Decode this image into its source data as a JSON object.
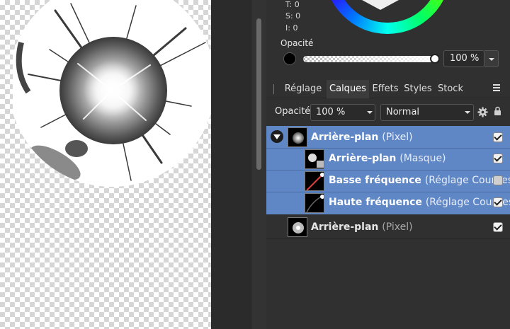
{
  "color_panel": {
    "readouts": [
      "T: 0",
      "S: 0",
      "I: 0"
    ],
    "opacity_label": "Opacité",
    "opacity_value": "100 %",
    "opacity_fraction": 1.0,
    "swatch_color": "#000000"
  },
  "tabs": [
    {
      "label": "Réglage",
      "active": false
    },
    {
      "label": "Calques",
      "active": true
    },
    {
      "label": "Effets",
      "active": false
    },
    {
      "label": "Styles",
      "active": false
    },
    {
      "label": "Stock",
      "active": false
    }
  ],
  "layers_toolbar": {
    "opacity_label": "Opacité:",
    "opacity_value": "100 %",
    "blend_mode": "Normal"
  },
  "layers": [
    {
      "name": "Arrière-plan",
      "type": "(Pixel)",
      "checked": true,
      "selected": true,
      "expanded": true,
      "indent": 0,
      "thumb": "starburst"
    },
    {
      "name": "Arrière-plan",
      "type": "(Masque)",
      "checked": true,
      "selected": true,
      "indent": 1,
      "thumb": "starburst-mask"
    },
    {
      "name": "Basse fréquence",
      "type": "(Réglage Courbes)",
      "checked": false,
      "selected": true,
      "indent": 1,
      "thumb": "curves-off"
    },
    {
      "name": "Haute fréquence",
      "type": "(Réglage Courbes)",
      "checked": true,
      "selected": true,
      "indent": 1,
      "thumb": "curves"
    },
    {
      "name": "Arrière-plan",
      "type": "(Pixel)",
      "checked": true,
      "selected": false,
      "indent": 0,
      "thumb": "starburst"
    }
  ],
  "colors": {
    "selection": "#5f87c6",
    "panel": "#303030"
  }
}
